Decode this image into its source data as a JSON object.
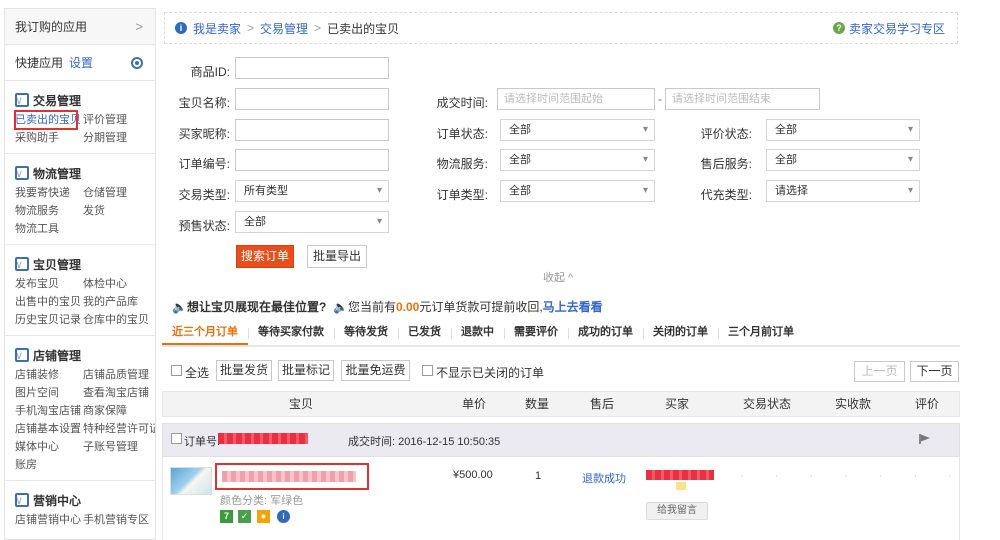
{
  "sidebar": {
    "my_apps": "我订购的应用",
    "quick_apps": "快捷应用",
    "settings": "设置",
    "sections": [
      {
        "title": "交易管理",
        "items": [
          "已卖出的宝贝",
          "评价管理",
          "采购助手",
          "分期管理"
        ]
      },
      {
        "title": "物流管理",
        "items": [
          "我要寄快递",
          "仓储管理",
          "物流服务",
          "发货",
          "物流工具"
        ]
      },
      {
        "title": "宝贝管理",
        "items": [
          "发布宝贝",
          "体检中心",
          "出售中的宝贝",
          "我的产品库",
          "历史宝贝记录",
          "仓库中的宝贝"
        ]
      },
      {
        "title": "店铺管理",
        "items": [
          "店铺装修",
          "店铺品质管理",
          "图片空间",
          "查看淘宝店铺",
          "手机淘宝店铺",
          "商家保障",
          "店铺基本设置",
          "特种经营许可证",
          "媒体中心",
          "子账号管理",
          "账房"
        ]
      },
      {
        "title": "营销中心",
        "items": [
          "店铺营销中心",
          "手机营销专区"
        ]
      }
    ]
  },
  "breadcrumb": {
    "items": [
      "我是卖家",
      "交易管理",
      "已卖出的宝贝"
    ],
    "separator": ">",
    "help_link": "卖家交易学习专区"
  },
  "form": {
    "product_id": "商品ID:",
    "product_name": "宝贝名称:",
    "buyer_nick": "买家昵称:",
    "order_no": "订单编号:",
    "trade_type": "交易类型:",
    "presale_status": "预售状态:",
    "deal_time": "成交时间:",
    "time_start_ph": "请选择时间范围起始",
    "time_end_ph": "请选择时间范围结束",
    "order_status": "订单状态:",
    "logistics": "物流服务:",
    "order_type": "订单类型:",
    "review_status": "评价状态:",
    "after_sale": "售后服务:",
    "recharge_type": "代充类型:",
    "trade_type_value": "所有类型",
    "all": "全部",
    "please_select": "请选择",
    "search_button": "搜索订单",
    "export_button": "批量导出",
    "collapse": "收起 ^"
  },
  "notice": {
    "left": "想让宝贝展现在最佳位置?",
    "mid_prefix": "您当前有",
    "amount": "0.00",
    "mid_suffix": "元订单货款可提前收回,",
    "link": "马上去看看"
  },
  "tabs": [
    "近三个月订单",
    "等待买家付款",
    "等待发货",
    "已发货",
    "退款中",
    "需要评价",
    "成功的订单",
    "关闭的订单",
    "三个月前订单"
  ],
  "toolbar": {
    "select_all": "全选",
    "batch_ship": "批量发货",
    "batch_mark": "批量标记",
    "batch_free_shipping": "批量免运费",
    "hide_closed": "不显示已关闭的订单",
    "prev": "上一页",
    "next": "下一页"
  },
  "table": {
    "headers": [
      "宝贝",
      "单价",
      "数量",
      "售后",
      "买家",
      "交易状态",
      "实收款",
      "评价"
    ]
  },
  "order": {
    "order_no_label": "订单号:",
    "deal_time": "成交时间: 2016-12-15 10:50:35",
    "price": "¥500.00",
    "quantity": "1",
    "after_sale": "退款成功",
    "color": "颜色分类: 军绿色",
    "leave_message": "给我留言"
  },
  "colors": {
    "accent": "#e84e1b",
    "link": "#3366cc",
    "highlight_box": "#dd3333"
  }
}
